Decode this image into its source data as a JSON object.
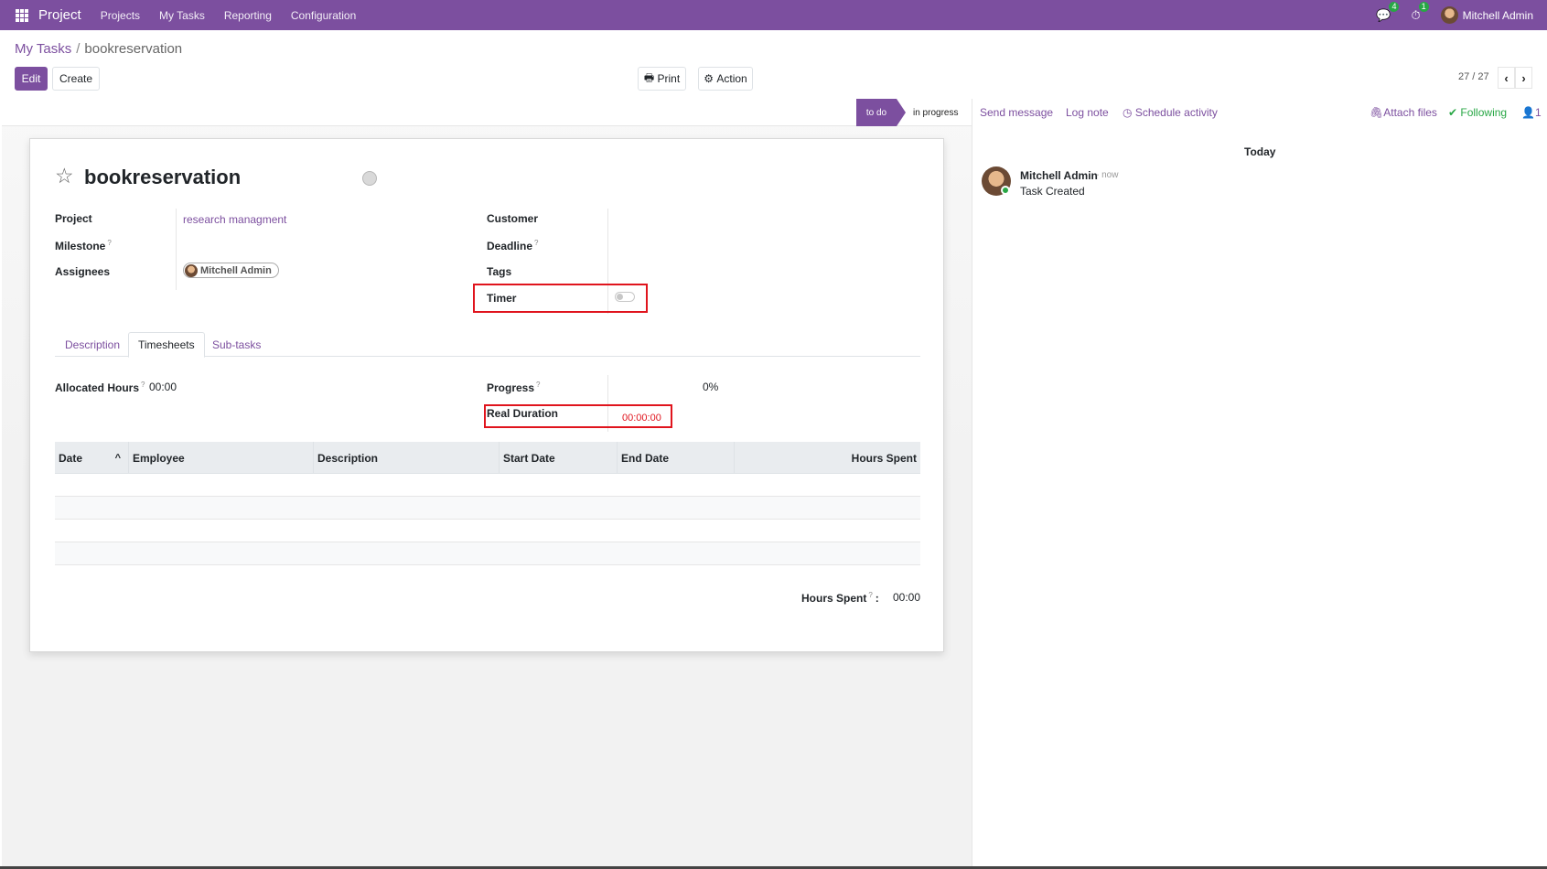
{
  "navbar": {
    "app_name": "Project",
    "menu": [
      "Projects",
      "My Tasks",
      "Reporting",
      "Configuration"
    ],
    "messages_count": "4",
    "activities_count": "1",
    "user_name": "Mitchell Admin"
  },
  "breadcrumb": {
    "parent": "My Tasks",
    "current": "bookreservation"
  },
  "toolbar": {
    "edit": "Edit",
    "create": "Create",
    "print": "Print",
    "action": "Action"
  },
  "pager": {
    "text": "27 / 27"
  },
  "stages": {
    "active": "to do",
    "next": "in progress"
  },
  "task": {
    "title": "bookreservation",
    "project_label": "Project",
    "project_value": "research managment",
    "milestone_label": "Milestone",
    "assignees_label": "Assignees",
    "assignee": "Mitchell Admin",
    "customer_label": "Customer",
    "deadline_label": "Deadline",
    "tags_label": "Tags",
    "timer_label": "Timer",
    "timer_on": false,
    "help_mark": "?"
  },
  "tabs": [
    "Description",
    "Timesheets",
    "Sub-tasks"
  ],
  "timesheets": {
    "allocated_label": "Allocated Hours",
    "allocated_value": "00:00",
    "progress_label": "Progress",
    "progress_value": "0%",
    "real_duration_label": "Real Duration",
    "real_duration_value": "00:00:00",
    "columns": [
      "Date",
      "Employee",
      "Description",
      "Start Date",
      "End Date",
      "Hours Spent"
    ],
    "total_label": "Hours Spent",
    "total_suffix": ":",
    "total_value": "00:00"
  },
  "chatter": {
    "send_message": "Send message",
    "log_note": "Log note",
    "schedule_activity": "Schedule activity",
    "attach_files": "Attach files",
    "following": "Following",
    "followers_count": "1",
    "day_label": "Today",
    "message_author": "Mitchell Admin",
    "message_time": "- now",
    "message_body": "Task Created"
  },
  "colors": {
    "brand": "#7c4f9f",
    "highlight": "#e0141d",
    "online": "#28a745"
  }
}
